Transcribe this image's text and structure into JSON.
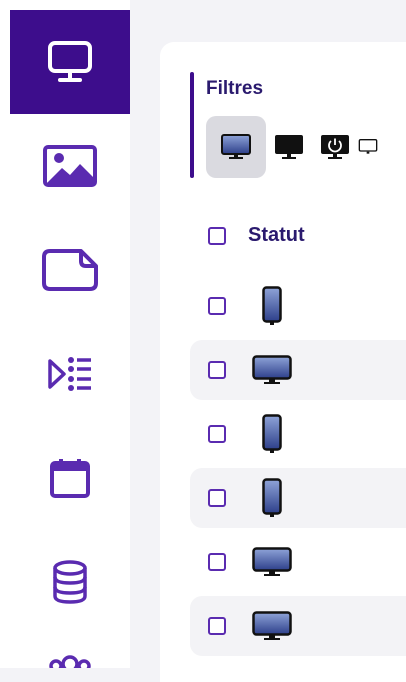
{
  "sidebar": {
    "items": [
      {
        "icon": "monitor-icon",
        "active": true
      },
      {
        "icon": "image-icon",
        "active": false
      },
      {
        "icon": "page-icon",
        "active": false
      },
      {
        "icon": "playlist-icon",
        "active": false
      },
      {
        "icon": "calendar-icon",
        "active": false
      },
      {
        "icon": "database-icon",
        "active": false
      },
      {
        "icon": "users-icon",
        "active": false
      }
    ]
  },
  "filters": {
    "title": "Filtres",
    "buttons": [
      {
        "icon": "screen-on-icon",
        "selected": true
      },
      {
        "icon": "screen-off-icon",
        "selected": false
      },
      {
        "icon": "power-icon",
        "selected": false
      },
      {
        "icon": "screen-outline-icon",
        "selected": false
      }
    ]
  },
  "table": {
    "status_header": "Statut",
    "rows": [
      {
        "device": "tablet-portrait-icon"
      },
      {
        "device": "monitor-landscape-icon"
      },
      {
        "device": "tablet-portrait-icon"
      },
      {
        "device": "tablet-portrait-icon"
      },
      {
        "device": "monitor-landscape-icon"
      },
      {
        "device": "monitor-landscape-icon"
      }
    ]
  },
  "colors": {
    "accent": "#3d0d8c",
    "icon": "#5a2bb0",
    "text": "#2a1a6e",
    "row_alt": "#f3f3f6"
  }
}
